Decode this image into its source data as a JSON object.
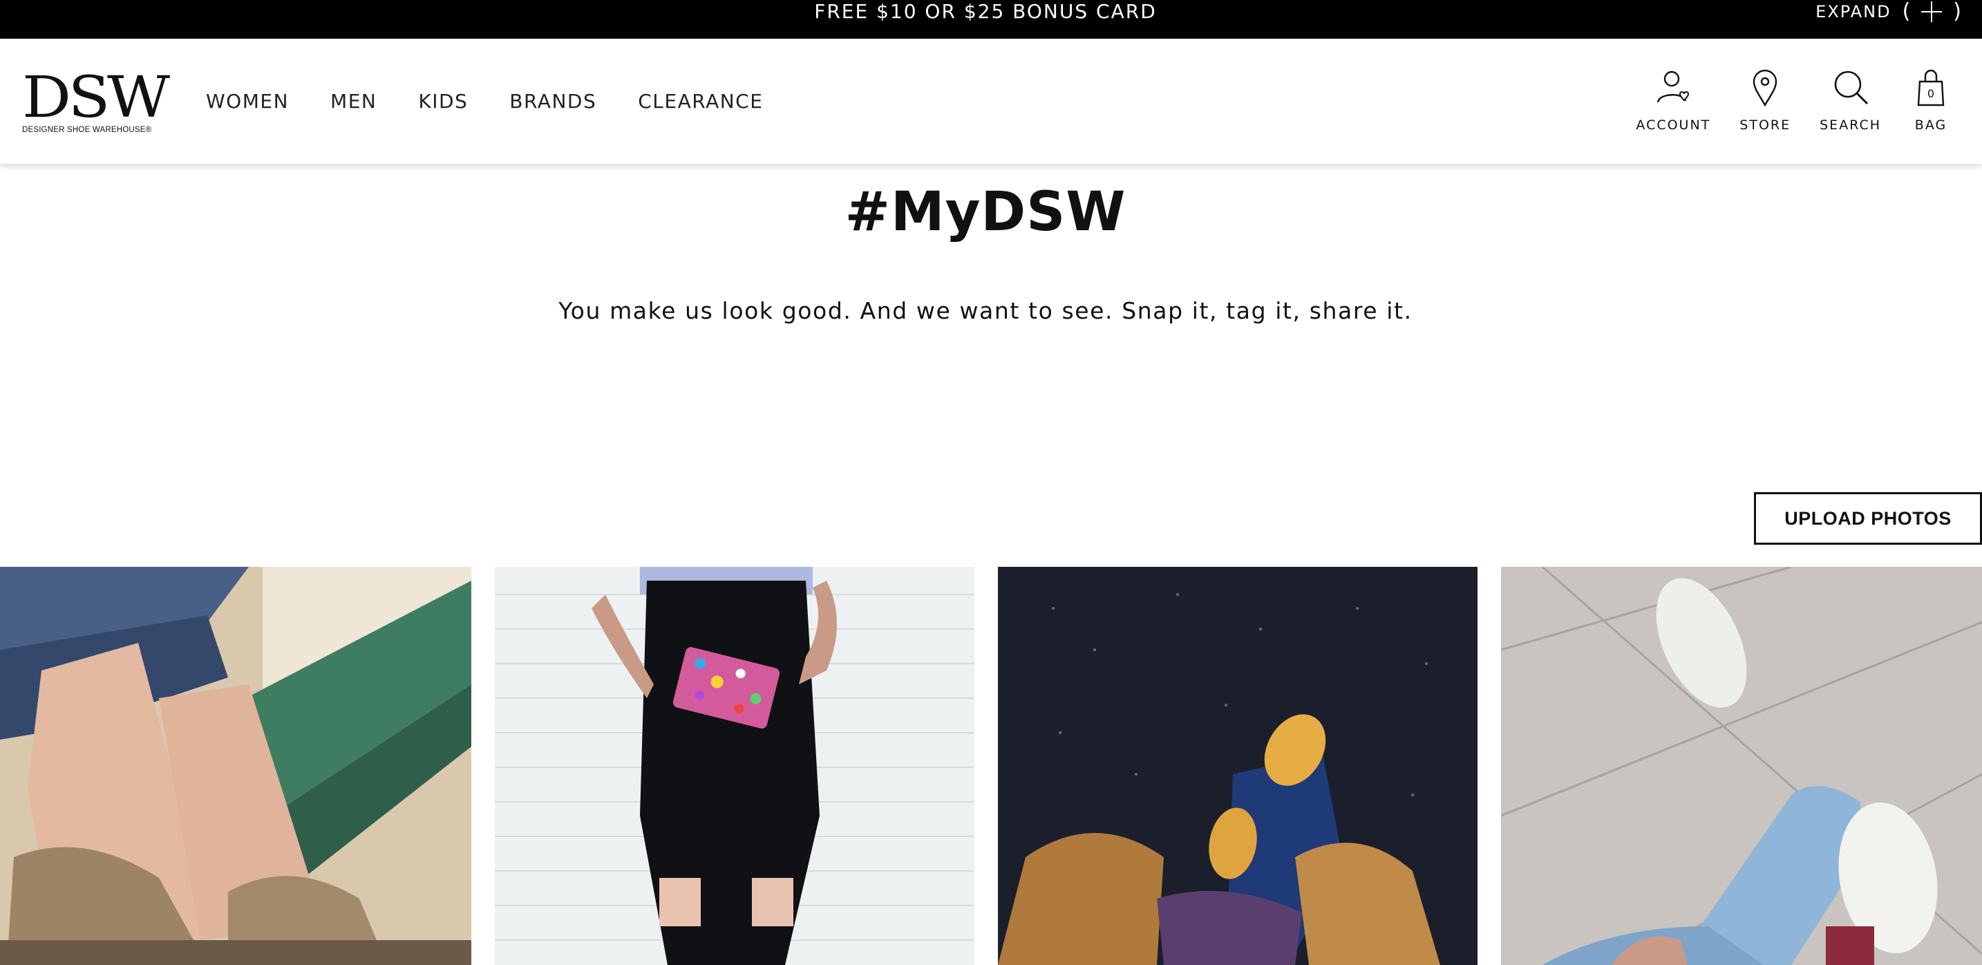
{
  "promo": {
    "text": "FREE $10 OR $25 BONUS CARD",
    "expand_label": "EXPAND",
    "expand_paren_open": "(",
    "expand_paren_close": ")"
  },
  "logo": {
    "mark": "DSW",
    "subtitle": "DESIGNER SHOE WAREHOUSE®"
  },
  "nav": {
    "items": [
      "WOMEN",
      "MEN",
      "KIDS",
      "BRANDS",
      "CLEARANCE"
    ]
  },
  "utilities": {
    "account": "ACCOUNT",
    "store": "STORE",
    "search": "SEARCH",
    "bag": "BAG",
    "bag_count": "0"
  },
  "hero": {
    "title": "#MyDSW",
    "subtitle": "You make us look good. And we want to see. Snap it, tag it, share it."
  },
  "upload_button": "UPLOAD PHOTOS",
  "gallery": {
    "photos": [
      {
        "subject": "tan perforated loafers on green bench"
      },
      {
        "subject": "black overalls with sequin clutch against white brick wall"
      },
      {
        "subject": "yellow suede sneakers on dark pavement"
      },
      {
        "subject": "white slip-on sneakers on stone tile floor"
      }
    ]
  },
  "colors": {
    "promo_bg": "#000000",
    "text": "#111111",
    "background": "#ffffff"
  }
}
